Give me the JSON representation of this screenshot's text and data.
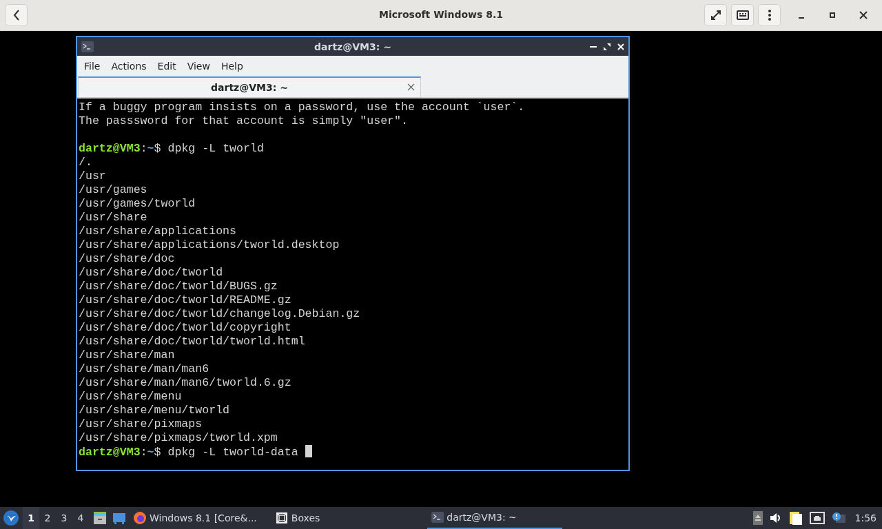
{
  "header": {
    "title": "Microsoft Windows 8.1"
  },
  "terminal_window": {
    "title": "dartz@VM3: ~",
    "menu": [
      "File",
      "Actions",
      "Edit",
      "View",
      "Help"
    ],
    "tabs": [
      {
        "label": "dartz@VM3: ~",
        "selected": true
      }
    ],
    "lines": [
      {
        "kind": "text",
        "text": "If a buggy program insists on a password, use the account `user`."
      },
      {
        "kind": "text",
        "text": "The passsword for that account is simply \"user\"."
      },
      {
        "kind": "blank"
      },
      {
        "kind": "prompt",
        "user": "dartz@VM3",
        "sep": ":",
        "path": "~",
        "symbol": "$",
        "command": "dpkg -L tworld",
        "cursor": false
      },
      {
        "kind": "text",
        "text": "/."
      },
      {
        "kind": "text",
        "text": "/usr"
      },
      {
        "kind": "text",
        "text": "/usr/games"
      },
      {
        "kind": "text",
        "text": "/usr/games/tworld"
      },
      {
        "kind": "text",
        "text": "/usr/share"
      },
      {
        "kind": "text",
        "text": "/usr/share/applications"
      },
      {
        "kind": "text",
        "text": "/usr/share/applications/tworld.desktop"
      },
      {
        "kind": "text",
        "text": "/usr/share/doc"
      },
      {
        "kind": "text",
        "text": "/usr/share/doc/tworld"
      },
      {
        "kind": "text",
        "text": "/usr/share/doc/tworld/BUGS.gz"
      },
      {
        "kind": "text",
        "text": "/usr/share/doc/tworld/README.gz"
      },
      {
        "kind": "text",
        "text": "/usr/share/doc/tworld/changelog.Debian.gz"
      },
      {
        "kind": "text",
        "text": "/usr/share/doc/tworld/copyright"
      },
      {
        "kind": "text",
        "text": "/usr/share/doc/tworld/tworld.html"
      },
      {
        "kind": "text",
        "text": "/usr/share/man"
      },
      {
        "kind": "text",
        "text": "/usr/share/man/man6"
      },
      {
        "kind": "text",
        "text": "/usr/share/man/man6/tworld.6.gz"
      },
      {
        "kind": "text",
        "text": "/usr/share/menu"
      },
      {
        "kind": "text",
        "text": "/usr/share/menu/tworld"
      },
      {
        "kind": "text",
        "text": "/usr/share/pixmaps"
      },
      {
        "kind": "text",
        "text": "/usr/share/pixmaps/tworld.xpm"
      },
      {
        "kind": "prompt",
        "user": "dartz@VM3",
        "sep": ":",
        "path": "~",
        "symbol": "$",
        "command": "dpkg -L tworld-data ",
        "cursor": true
      }
    ]
  },
  "taskbar": {
    "desktops": [
      {
        "label": "1",
        "selected": true
      },
      {
        "label": "2",
        "selected": false
      },
      {
        "label": "3",
        "selected": false
      },
      {
        "label": "4",
        "selected": false
      }
    ],
    "tasks": [
      {
        "kind": "firefox",
        "label": "Windows 8.1 [Core&...",
        "selected": false
      },
      {
        "kind": "boxes",
        "label": "Boxes",
        "selected": false
      },
      {
        "kind": "terminal",
        "label": "dartz@VM3: ~",
        "selected": true
      }
    ],
    "clock": "1:56"
  }
}
